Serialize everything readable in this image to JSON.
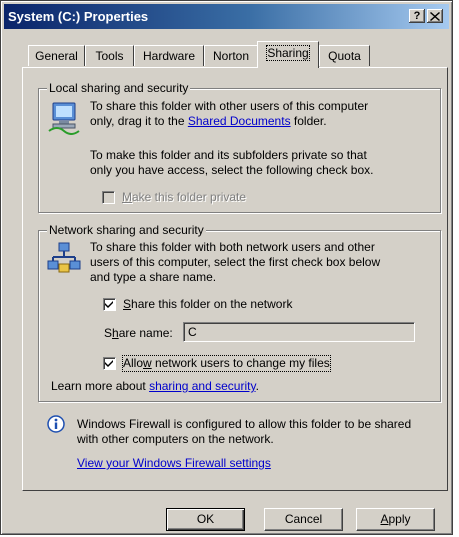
{
  "window": {
    "title": "System (C:) Properties",
    "help_label": "?",
    "close_label": "✕"
  },
  "tabs": [
    {
      "label": "General",
      "active": false
    },
    {
      "label": "Tools",
      "active": false
    },
    {
      "label": "Hardware",
      "active": false
    },
    {
      "label": "Norton",
      "active": false
    },
    {
      "label": "Sharing",
      "active": true
    },
    {
      "label": "Quota",
      "active": false
    }
  ],
  "local": {
    "legend": "Local sharing and security",
    "icon": "computer-network-icon",
    "para1_line1": "To share this folder with other users of this computer",
    "para1_line2_pre": "only, drag it to the ",
    "para1_link": "Shared Documents",
    "para1_line2_post": " folder.",
    "para2_line1": "To make this folder and its subfolders private so that",
    "para2_line2": "only you have access, select the following check box.",
    "private_checkbox": {
      "label_prefix": "M",
      "label_rest": "ake this folder private",
      "checked": false,
      "enabled": false
    }
  },
  "network": {
    "legend": "Network sharing and security",
    "icon": "network-share-icon",
    "para_line1": "To share this folder with both network users and other",
    "para_line2": "users of this computer, select the first check box below",
    "para_line3": "and type a share name.",
    "share_checkbox": {
      "label_prefix": "S",
      "label_rest": "hare this folder on the network",
      "checked": true
    },
    "share_name_label_pre": "S",
    "share_name_label_u": "h",
    "share_name_label_post": "are name:",
    "share_name_value": "C",
    "allow_checkbox": {
      "label_pre": "Allo",
      "label_u": "w",
      "label_post": " network users to change my files",
      "checked": true
    },
    "learn_more_pre": "Learn more about ",
    "learn_more_link": "sharing and security",
    "learn_more_post": "."
  },
  "firewall": {
    "icon": "info-icon",
    "line1": "Windows Firewall is configured to allow this folder to be shared",
    "line2": "with other computers on the network.",
    "link": "View your Windows Firewall settings"
  },
  "buttons": {
    "ok": "OK",
    "cancel": "Cancel",
    "apply_u": "A",
    "apply_rest": "pply"
  },
  "colors": {
    "titlebar_start": "#0a246a",
    "titlebar_end": "#a6caf0",
    "face": "#d4d0c8",
    "link": "#0000cc"
  }
}
